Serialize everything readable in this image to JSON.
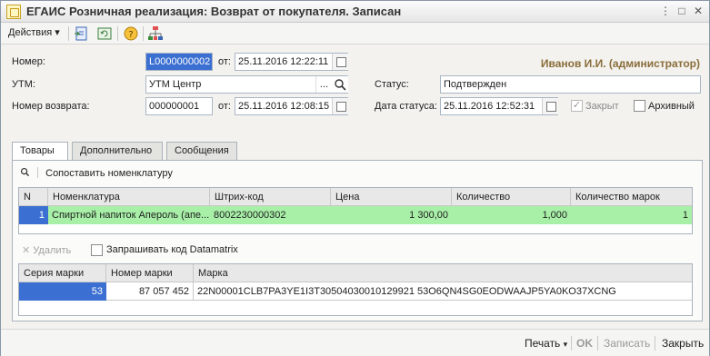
{
  "window": {
    "title": "ЕГАИС Розничная реализация: Возврат от покупателя. Записан"
  },
  "toolbar": {
    "actions_label": "Действия"
  },
  "form": {
    "number_label": "Номер:",
    "number_value": "L0000000002",
    "from_label": "от:",
    "number_date": "25.11.2016 12:22:11",
    "user": "Иванов И.И. (администратор)",
    "utm_label": "УТМ:",
    "utm_value": "УТМ Центр",
    "utm_button": "...",
    "status_label": "Статус:",
    "status_value": "Подтвержден",
    "return_label": "Номер возврата:",
    "return_value": "000000001",
    "return_from_label": "от:",
    "return_date": "25.11.2016 12:08:15",
    "status_date_label": "Дата статуса:",
    "status_date": "25.11.2016 12:52:31",
    "closed_label": "Закрыт",
    "archive_label": "Архивный"
  },
  "tabs": [
    "Товары",
    "Дополнительно",
    "Сообщения"
  ],
  "goods": {
    "match_label": "Сопоставить номенклатуру",
    "columns": [
      "N",
      "Номенклатура",
      "Штрих-код",
      "Цена",
      "Количество",
      "Количество марок"
    ],
    "rows": [
      {
        "n": "1",
        "name": "Спиртной напиток Апероль (апе...",
        "barcode": "8002230000302",
        "price": "1 300,00",
        "qty": "1,000",
        "marks": "1"
      }
    ]
  },
  "marks": {
    "delete_label": "Удалить",
    "request_label": "Запрашивать код Datamatrix",
    "columns": [
      "Серия марки",
      "Номер марки",
      "Марка"
    ],
    "rows": [
      {
        "series": "53",
        "number": "87 057 452",
        "mark": "22N00001CLB7PA3YE1I3T30504030010129921 53O6QN4SG0EODWAAJP5YA0KO37XCNG"
      }
    ]
  },
  "footer": {
    "print_label": "Печать",
    "ok_label": "OK",
    "save_label": "Записать",
    "close_label": "Закрыть"
  }
}
